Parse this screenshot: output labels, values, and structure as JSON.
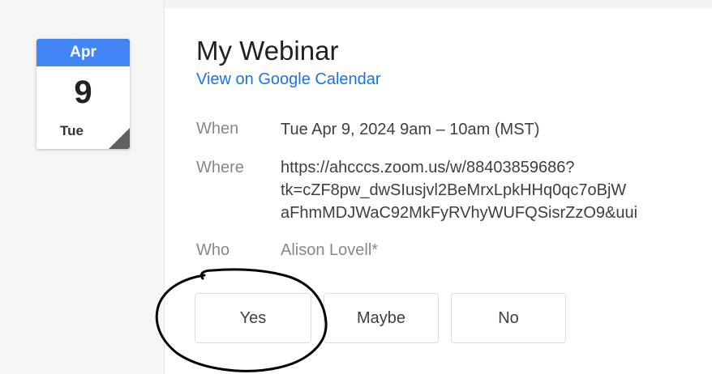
{
  "calendar_icon": {
    "month": "Apr",
    "day": "9",
    "weekday": "Tue"
  },
  "event": {
    "title": "My Webinar",
    "calendar_link": "View on Google Calendar",
    "when_label": "When",
    "when_value": "Tue Apr 9, 2024 9am – 10am (MST)",
    "where_label": "Where",
    "where_lines": [
      "https://ahcccs.zoom.us/w/88403859686?",
      "tk=cZF8pw_dwSIusjvl2BeMrxLpkHHq0qc7oBjW",
      "aFhmMDJWaC92MkFyRVhyWUFQSisrZzO9&uui"
    ],
    "who_label": "Who",
    "who_value": "Alison Lovell*"
  },
  "rsvp": {
    "yes_label": "Yes",
    "maybe_label": "Maybe",
    "no_label": "No"
  },
  "colors": {
    "month_header": "#4285f4",
    "link": "#1a73e8",
    "annotation_ink": "#000000"
  }
}
